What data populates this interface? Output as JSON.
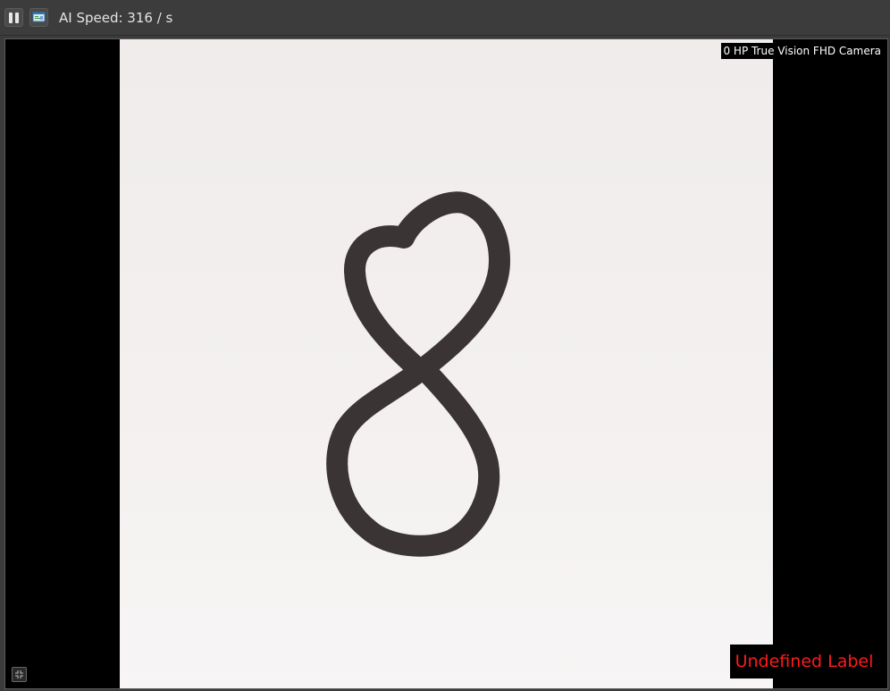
{
  "toolbar": {
    "pause_icon": "pause-icon",
    "screen_icon": "screen-capture-icon",
    "ai_speed_label": "AI Speed: 316 / s"
  },
  "viewport": {
    "camera_name": "0 HP True Vision FHD Camera",
    "prediction_label": "Undefined Label",
    "prediction_color": "#ff1a1a",
    "fullscreen_icon": "collapse-icon"
  }
}
